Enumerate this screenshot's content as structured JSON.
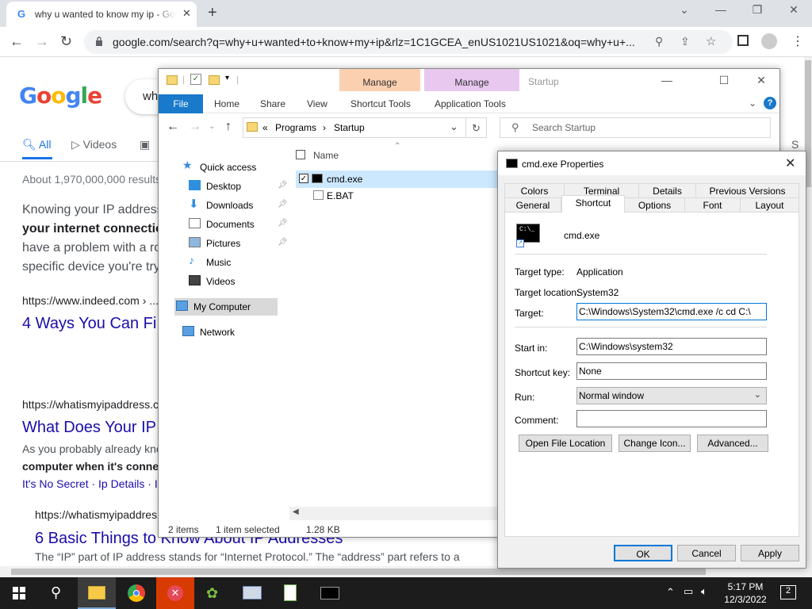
{
  "chrome": {
    "tab_title": "why u wanted to know my ip - Google Search",
    "tab_close": "✕",
    "new_tab": "+",
    "url": "google.com/search?q=why+u+wanted+to+know+my+ip&rlz=1C1GCEA_enUS1021US1021&oq=why+u+...",
    "win_min": "⌄",
    "win_min2": "—",
    "win_restore": "❐",
    "win_close": "✕"
  },
  "google": {
    "logo": "Google",
    "search_text": "wh",
    "tabs": {
      "all": "All",
      "videos": "Videos"
    },
    "results_count": "About 1,970,000,000 results",
    "snippet1": {
      "line1": "Knowing your IP address",
      "line2": "your internet connectio",
      "line3": "have a problem with a ro",
      "line4": "specific device you're try"
    },
    "result1": {
      "cite": "https://www.indeed.com › ...",
      "title": "4 Ways You Can Fi"
    },
    "result2": {
      "cite": "https://whatismyipaddress.c",
      "title": "What Does Your IP",
      "snip1": "As you probably already kno",
      "snip2": "computer when it's conne",
      "links": "It's No Secret · Ip Details · I"
    },
    "result3": {
      "cite": "https://whatismyipaddres",
      "title": "6 Basic Things to Know About IP Addresses",
      "snip": "The “IP” part of IP address stands for “Internet Protocol.” The “address” part refers to a"
    },
    "s_letter": "S"
  },
  "explorer": {
    "manage1": "Manage",
    "manage2": "Manage",
    "title": "Startup",
    "ribbon": {
      "file": "File",
      "home": "Home",
      "share": "Share",
      "view": "View",
      "shortcut_tools": "Shortcut Tools",
      "app_tools": "Application Tools",
      "help": "?"
    },
    "address": {
      "prefix": "«",
      "part1": "Programs",
      "sep": "›",
      "part2": "Startup"
    },
    "search_placeholder": "Search Startup",
    "nav": {
      "quick_access": "Quick access",
      "desktop": "Desktop",
      "downloads": "Downloads",
      "documents": "Documents",
      "pictures": "Pictures",
      "music": "Music",
      "videos": "Videos",
      "my_computer": "My Computer",
      "network": "Network"
    },
    "list": {
      "header_name": "Name",
      "files": [
        "cmd.exe",
        "E.BAT"
      ]
    },
    "status": {
      "items": "2 items",
      "selected": "1 item selected",
      "size": "1.28 KB"
    }
  },
  "props": {
    "title": "cmd.exe Properties",
    "tabs_row1": [
      "Colors",
      "Terminal",
      "Details",
      "Previous Versions"
    ],
    "tabs_row2": [
      "General",
      "Shortcut",
      "Options",
      "Font",
      "Layout"
    ],
    "name": "cmd.exe",
    "icon_text": "C:\\_",
    "target_type_label": "Target type:",
    "target_type": "Application",
    "target_location_label": "Target location:",
    "target_location": "System32",
    "target_label": "Target:",
    "target": "C:\\Windows\\System32\\cmd.exe /c cd C:\\",
    "start_in_label": "Start in:",
    "start_in": "C:\\Windows\\system32",
    "shortcut_key_label": "Shortcut key:",
    "shortcut_key": "None",
    "run_label": "Run:",
    "run": "Normal window",
    "comment_label": "Comment:",
    "comment": "",
    "btn_open_location": "Open File Location",
    "btn_change_icon": "Change Icon...",
    "btn_advanced": "Advanced...",
    "btn_ok": "OK",
    "btn_cancel": "Cancel",
    "btn_apply": "Apply"
  },
  "taskbar": {
    "time": "5:17 PM",
    "date": "12/3/2022",
    "notifications": "2"
  },
  "colors": {
    "google_blue": "#4285f4",
    "google_red": "#ea4335",
    "google_yellow": "#fbbc05",
    "google_green": "#34a853",
    "link": "#1a0dab",
    "accent": "#0078d7"
  },
  "icons": [
    "google-favicon",
    "lock-icon",
    "back-arrow-icon",
    "forward-arrow-icon",
    "reload-icon",
    "location-icon",
    "share-icon",
    "star-icon",
    "sidepanel-icon",
    "profile-icon",
    "kebab-menu-icon",
    "folder-icon",
    "star-icon",
    "pin-icon",
    "cmd-icon",
    "windows-start-icon",
    "search-icon"
  ]
}
